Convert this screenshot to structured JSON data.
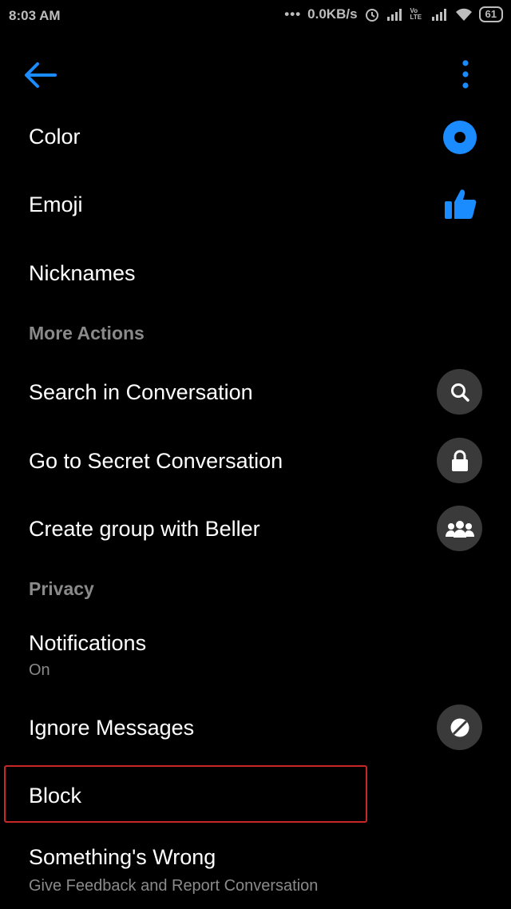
{
  "status_bar": {
    "time": "8:03 AM",
    "network_speed": "0.0KB/s",
    "battery": "61",
    "volte": "Vo LTE"
  },
  "toolbar": {
    "back_icon": "back-arrow-icon",
    "more_icon": "more-vertical-icon"
  },
  "accent_color": "#1a8cff",
  "settings": {
    "color_label": "Color",
    "emoji_label": "Emoji",
    "nicknames_label": "Nicknames",
    "more_actions_header": "More Actions",
    "search_label": "Search in Conversation",
    "secret_label": "Go to Secret Conversation",
    "group_label": "Create group with Beller",
    "privacy_header": "Privacy",
    "notifications_label": "Notifications",
    "notifications_value": "On",
    "ignore_label": "Ignore Messages",
    "block_label": "Block",
    "wrong_label": "Something's Wrong",
    "wrong_sublabel": "Give Feedback and Report Conversation"
  }
}
